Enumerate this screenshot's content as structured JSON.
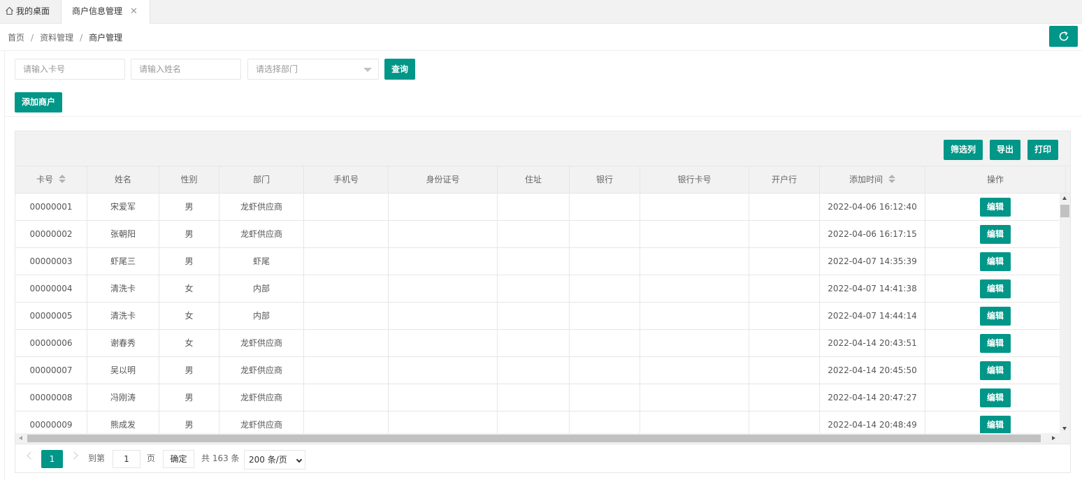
{
  "tabs": {
    "home_label": "我的桌面",
    "active_label": "商户信息管理",
    "close_glyph": "✕"
  },
  "breadcrumb": {
    "items": [
      "首页",
      "资料管理",
      "商户管理"
    ],
    "separator": "/"
  },
  "search": {
    "card_placeholder": "请输入卡号",
    "name_placeholder": "请输入姓名",
    "department_placeholder": "请选择部门",
    "query_label": "查询"
  },
  "actions": {
    "add_label": "添加商户"
  },
  "toolbar": {
    "filter_label": "筛选列",
    "export_label": "导出",
    "print_label": "打印"
  },
  "table": {
    "columns": [
      "卡号",
      "姓名",
      "性别",
      "部门",
      "手机号",
      "身份证号",
      "住址",
      "银行",
      "银行卡号",
      "开户行",
      "添加时间",
      "操作"
    ],
    "edit_label": "编辑",
    "rows": [
      {
        "card": "00000001",
        "name": "宋爱军",
        "gender": "男",
        "dept": "龙虾供应商",
        "time": "2022-04-06 16:12:40"
      },
      {
        "card": "00000002",
        "name": "张朝阳",
        "gender": "男",
        "dept": "龙虾供应商",
        "time": "2022-04-06 16:17:15"
      },
      {
        "card": "00000003",
        "name": "虾尾三",
        "gender": "男",
        "dept": "虾尾",
        "time": "2022-04-07 14:35:39"
      },
      {
        "card": "00000004",
        "name": "清洗卡",
        "gender": "女",
        "dept": "内部",
        "time": "2022-04-07 14:41:38"
      },
      {
        "card": "00000005",
        "name": "清洗卡",
        "gender": "女",
        "dept": "内部",
        "time": "2022-04-07 14:44:14"
      },
      {
        "card": "00000006",
        "name": "谢春秀",
        "gender": "女",
        "dept": "龙虾供应商",
        "time": "2022-04-14 20:43:51"
      },
      {
        "card": "00000007",
        "name": "吴以明",
        "gender": "男",
        "dept": "龙虾供应商",
        "time": "2022-04-14 20:45:50"
      },
      {
        "card": "00000008",
        "name": "冯刚涛",
        "gender": "男",
        "dept": "龙虾供应商",
        "time": "2022-04-14 20:47:27"
      },
      {
        "card": "00000009",
        "name": "熊成发",
        "gender": "男",
        "dept": "龙虾供应商",
        "time": "2022-04-14 20:48:49"
      }
    ]
  },
  "pager": {
    "current_page": "1",
    "goto_label": "到第",
    "goto_value": "1",
    "page_unit": "页",
    "confirm_label": "确定",
    "total_text": "共 163 条",
    "page_size": "200 条/页"
  },
  "colors": {
    "primary": "#009688",
    "header_bg": "#f2f2f2",
    "border": "#e6e6e6"
  }
}
